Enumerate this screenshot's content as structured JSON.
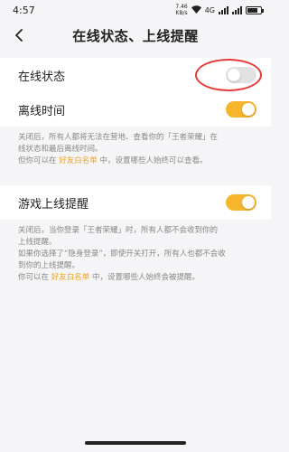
{
  "status_bar": {
    "time": "4:57",
    "net_speed": "7.46",
    "net_unit": "KB/s",
    "network_type": "4G",
    "battery_label": "battery"
  },
  "header": {
    "title": "在线状态、上线提醒",
    "back_icon": "chevron-left-icon"
  },
  "settings": {
    "online_status": {
      "label": "在线状态",
      "enabled": false
    },
    "offline_time": {
      "label": "离线时间",
      "enabled": true
    },
    "offline_desc": {
      "line1": "关闭后，所有人都将无法在营地、查看你的「王者荣耀」在",
      "line2": "线状态和最后离线时间。",
      "line3_prefix": "但你可以在",
      "line3_link": "好友白名单",
      "line3_suffix": "中，设置哪些人始终可以查看。"
    },
    "game_online_alert": {
      "label": "游戏上线提醒",
      "enabled": true
    },
    "alert_desc": {
      "line1": "关闭后，当你登录「王者荣耀」时，所有人都不会收到你的",
      "line2": "上线提醒。",
      "line3": "如果你选择了“隐身登录”，即使开关打开，所有人也都不会收",
      "line4": "到你的上线提醒。",
      "line5_prefix": "你可以在",
      "line5_link": "好友白名单",
      "line5_suffix": "中，设置哪些人始终会被提醒。"
    }
  },
  "colors": {
    "accent": "#f7b52c",
    "link": "#f0a21c",
    "highlight_circle": "#e53935",
    "toggle_off": "#e1e1e1"
  }
}
